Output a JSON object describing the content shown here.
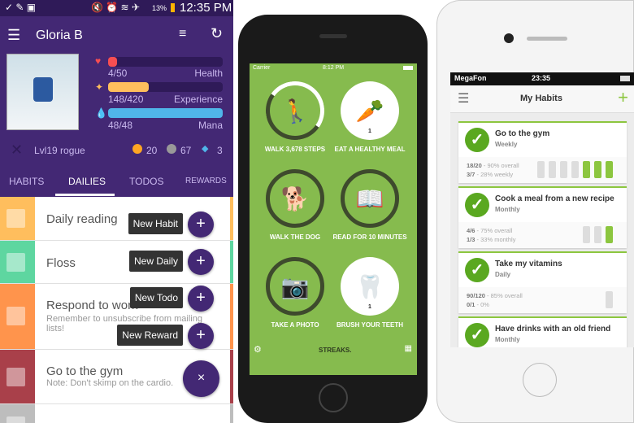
{
  "habitica": {
    "status": {
      "battery": "13%",
      "time": "12:35 PM"
    },
    "title": "Gloria B",
    "stats": [
      {
        "name": "Health",
        "value": "4/50",
        "fraction": 0.08,
        "color": "#f74e52"
      },
      {
        "name": "Experience",
        "value": "148/420",
        "fraction": 0.352,
        "color": "#ffbe5d"
      },
      {
        "name": "Mana",
        "value": "48/48",
        "fraction": 1.0,
        "color": "#50b5e9"
      }
    ],
    "level": "Lvl19 rogue",
    "gold": "20",
    "silver": "67",
    "gems": "3",
    "tabs": [
      "HABITS",
      "DAILIES",
      "TODOS",
      "REWARDS"
    ],
    "active_tab": "DAILIES",
    "tasks": [
      {
        "title": "Daily reading",
        "note": "",
        "color": "#ffbe5d"
      },
      {
        "title": "Floss",
        "note": "",
        "color": "#5ed6a0"
      },
      {
        "title": "Respond to work",
        "note": "Remember to unsubscribe from mailing lists!",
        "color": "#ff944c"
      },
      {
        "title": "Go to the gym",
        "note": "Note: Don't skimp on the cardio.",
        "color": "#a9404a"
      },
      {
        "title": "",
        "note": "",
        "color": "#bdbdbd"
      }
    ],
    "fab_menu": [
      "New Habit",
      "New Daily",
      "New Todo",
      "New Reward"
    ],
    "fab_close": "×"
  },
  "streaks": {
    "status": {
      "carrier": "Carrier",
      "time": "8:12 PM"
    },
    "items": [
      {
        "label": "WALK 3,678 STEPS",
        "icon": "walking-person-icon",
        "filled": false,
        "count": ""
      },
      {
        "label": "EAT A HEALTHY MEAL",
        "icon": "carrot-icon",
        "filled": true,
        "count": "1"
      },
      {
        "label": "WALK THE DOG",
        "icon": "dog-icon",
        "filled": false,
        "count": ""
      },
      {
        "label": "READ FOR 10 MINUTES",
        "icon": "book-icon",
        "filled": false,
        "count": ""
      },
      {
        "label": "TAKE A PHOTO",
        "icon": "camera-icon",
        "filled": false,
        "count": ""
      },
      {
        "label": "BRUSH YOUR TEETH",
        "icon": "tooth-icon",
        "filled": true,
        "count": "1"
      }
    ],
    "brand": "STREAKS."
  },
  "myhabits": {
    "status": {
      "carrier": "MegaFon",
      "time": "23:35"
    },
    "title": "My Habits",
    "habits": [
      {
        "title": "Go to the gym",
        "freq": "Weekly",
        "l1a": "18/20",
        "l1b": " - 90% overall",
        "l2a": "3/7",
        "l2b": " - 28% weekly",
        "blocks": [
          0,
          0,
          0,
          0,
          1,
          1,
          1
        ]
      },
      {
        "title": "Cook a meal from a new recipe",
        "freq": "Monthly",
        "l1a": "4/6",
        "l1b": " - 75% overall",
        "l2a": "1/3",
        "l2b": " - 33% monthly",
        "blocks": [
          0,
          0,
          1
        ]
      },
      {
        "title": "Take my vitamins",
        "freq": "Daily",
        "l1a": "90/120",
        "l1b": " - 85% overall",
        "l2a": "0/1",
        "l2b": " - 0%",
        "blocks": [
          0
        ]
      },
      {
        "title": "Have drinks with an old friend",
        "freq": "Monthly"
      }
    ]
  }
}
